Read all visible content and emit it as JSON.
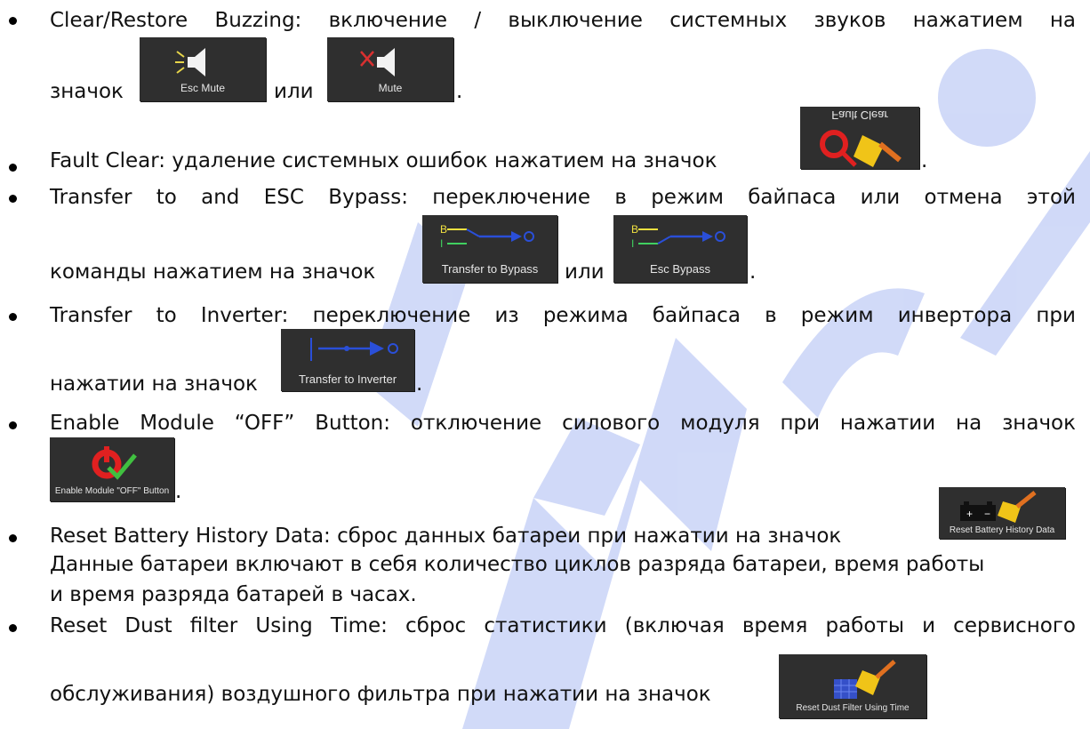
{
  "brand_color": "#2a4fd8",
  "watermark_color": "#2d55e0",
  "items": [
    {
      "line1": [
        "Clear/Restore",
        "Buzzing:",
        "включение",
        "/",
        "выключение",
        "системных",
        "звуков",
        "нажатием",
        "на"
      ],
      "line2_text": "значок",
      "conj": "или",
      "icon_a_label": "Esc Mute",
      "icon_b_label": "Mute"
    },
    {
      "text": "Fault Clear: удаление системных ошибок нажатием на значок",
      "icon_label": "Fault Clear"
    },
    {
      "line1": [
        "Transfer",
        "to",
        "and",
        "ESC",
        "Bypass:",
        "переключение",
        "в",
        "режим",
        "байпаса",
        "или",
        "отмена",
        "этой"
      ],
      "line2_text": "команды нажатием на значок",
      "conj": "или",
      "icon_a_label": "Transfer to Bypass",
      "icon_b_label": "Esc Bypass"
    },
    {
      "line1": [
        "Transfer",
        "to",
        "Inverter:",
        "переключение",
        "из",
        "режима",
        "байпаса",
        "в",
        "режим",
        "инвертора",
        "при"
      ],
      "line2_text": "нажатии на значок",
      "icon_label": "Transfer to Inverter"
    },
    {
      "text": "Enable Module “OFF” Button: отключение силового модуля при нажатии на значок",
      "icon_label": "Enable Module \"OFF\" Button"
    },
    {
      "text": "Reset Battery History Data: сброс данных батареи при нажатии на значок",
      "icon_label": "Reset Battery History Data",
      "cont1": "Данные батареи включают в себя количество циклов разряда батареи, время работы",
      "cont2": "и время разряда батарей в часах."
    },
    {
      "line1": [
        "Reset",
        "Dust",
        "filter",
        "Using",
        "Time:",
        "сброс",
        "статистики",
        "(включая",
        "время",
        "работы",
        "и",
        "сервисного"
      ],
      "line2_text": "обслуживания) воздушного фильтра при нажатии на значок",
      "icon_label": "Reset Dust Filter Using Time"
    }
  ],
  "period": "."
}
